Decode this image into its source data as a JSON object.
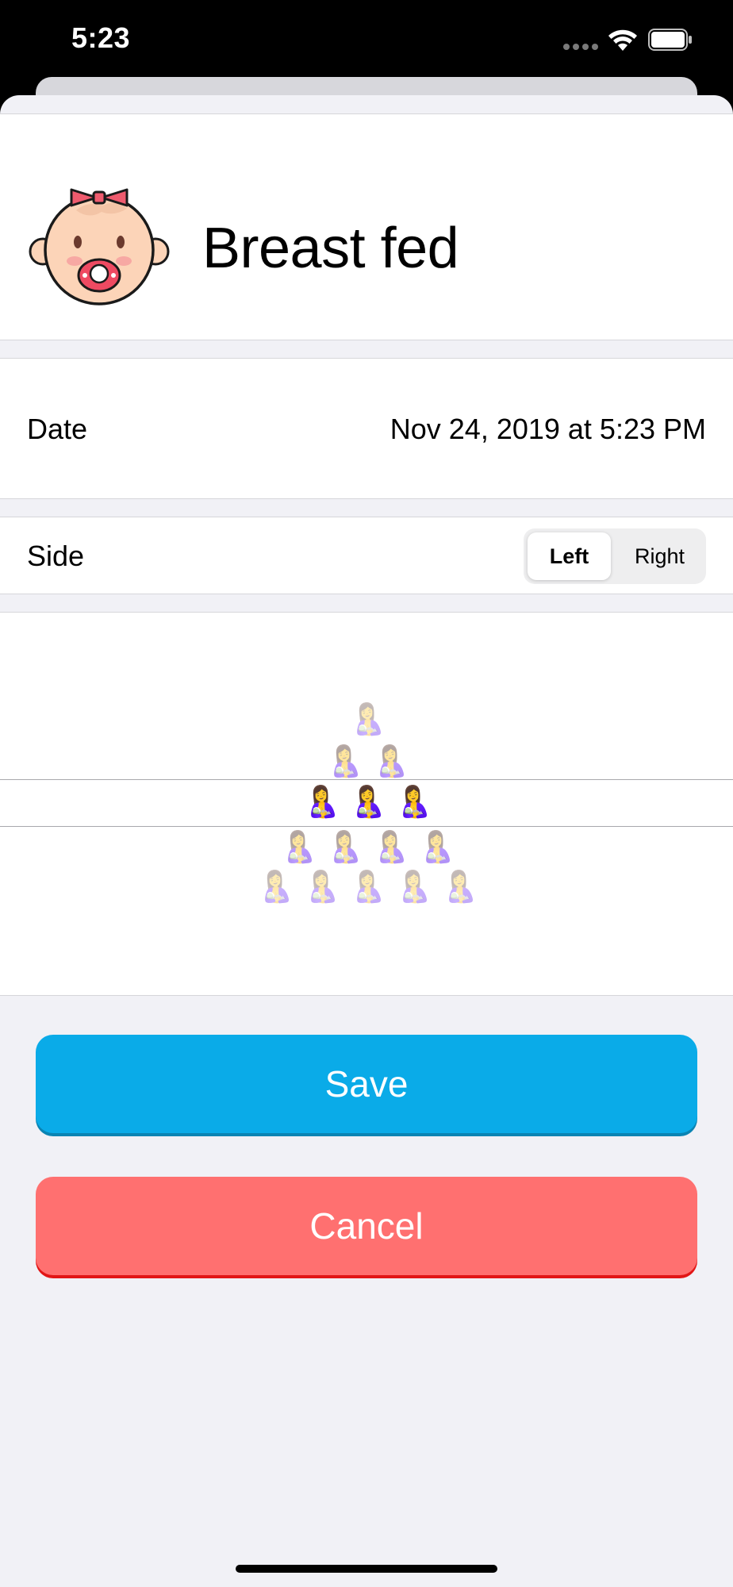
{
  "status_bar": {
    "time": "5:23"
  },
  "header": {
    "title": "Breast fed",
    "icon": "baby-face-icon"
  },
  "date_row": {
    "label": "Date",
    "value": "Nov 24, 2019 at 5:23 PM"
  },
  "side_row": {
    "label": "Side",
    "options": [
      "Left",
      "Right"
    ],
    "selected": "Left"
  },
  "picker": {
    "emoji": "🤱",
    "rows": [
      {
        "count": 1,
        "opacity": 0.35
      },
      {
        "count": 2,
        "opacity": 0.45
      },
      {
        "count": 3,
        "opacity": 1.0,
        "selected": true
      },
      {
        "count": 4,
        "opacity": 0.45
      },
      {
        "count": 5,
        "opacity": 0.35
      }
    ]
  },
  "actions": {
    "save_label": "Save",
    "cancel_label": "Cancel"
  },
  "colors": {
    "save": "#0aabe8",
    "cancel": "#ff7070",
    "background": "#f1f1f6"
  }
}
